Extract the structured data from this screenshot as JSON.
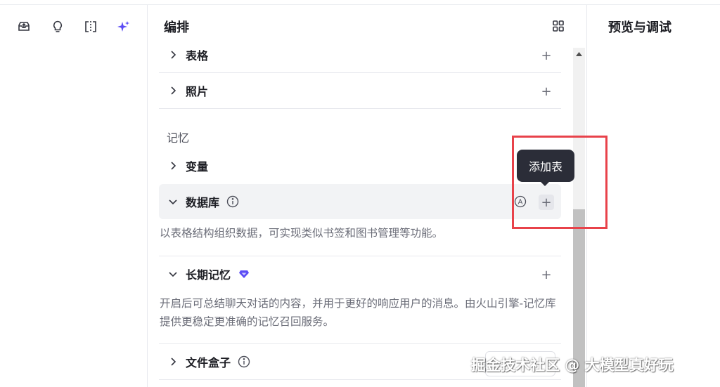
{
  "rail": {
    "icons": [
      "inbox-upload-icon",
      "lightbulb-icon",
      "split-view-icon",
      "sparkle-icon"
    ],
    "accent": "#5b4cf5"
  },
  "panel": {
    "title": "编排",
    "rows": {
      "table": "表格",
      "photo": "照片",
      "variable": "变量",
      "database": "数据库",
      "long_memory": "长期记忆",
      "file_box": "文件盒子"
    },
    "memory_section": "记忆",
    "database_desc": "以表格结构组织数据，可实现类似书签和图书管理等功能。",
    "long_memory_desc": "开启后可总结聊天对话的内容，并用于更好的响应用户的消息。由火山引擎-记忆库提供更稳定更准确的记忆召回服务。",
    "plus_label": "+",
    "a_badge": "A"
  },
  "right": {
    "title": "预览与调试"
  },
  "tooltip": {
    "text": "添加表"
  },
  "watermark": {
    "text": "掘金技术社区 @ 大模型真好玩"
  },
  "colors": {
    "highlight_border": "#e8424a",
    "premium_gem": "#5b4cf5"
  }
}
